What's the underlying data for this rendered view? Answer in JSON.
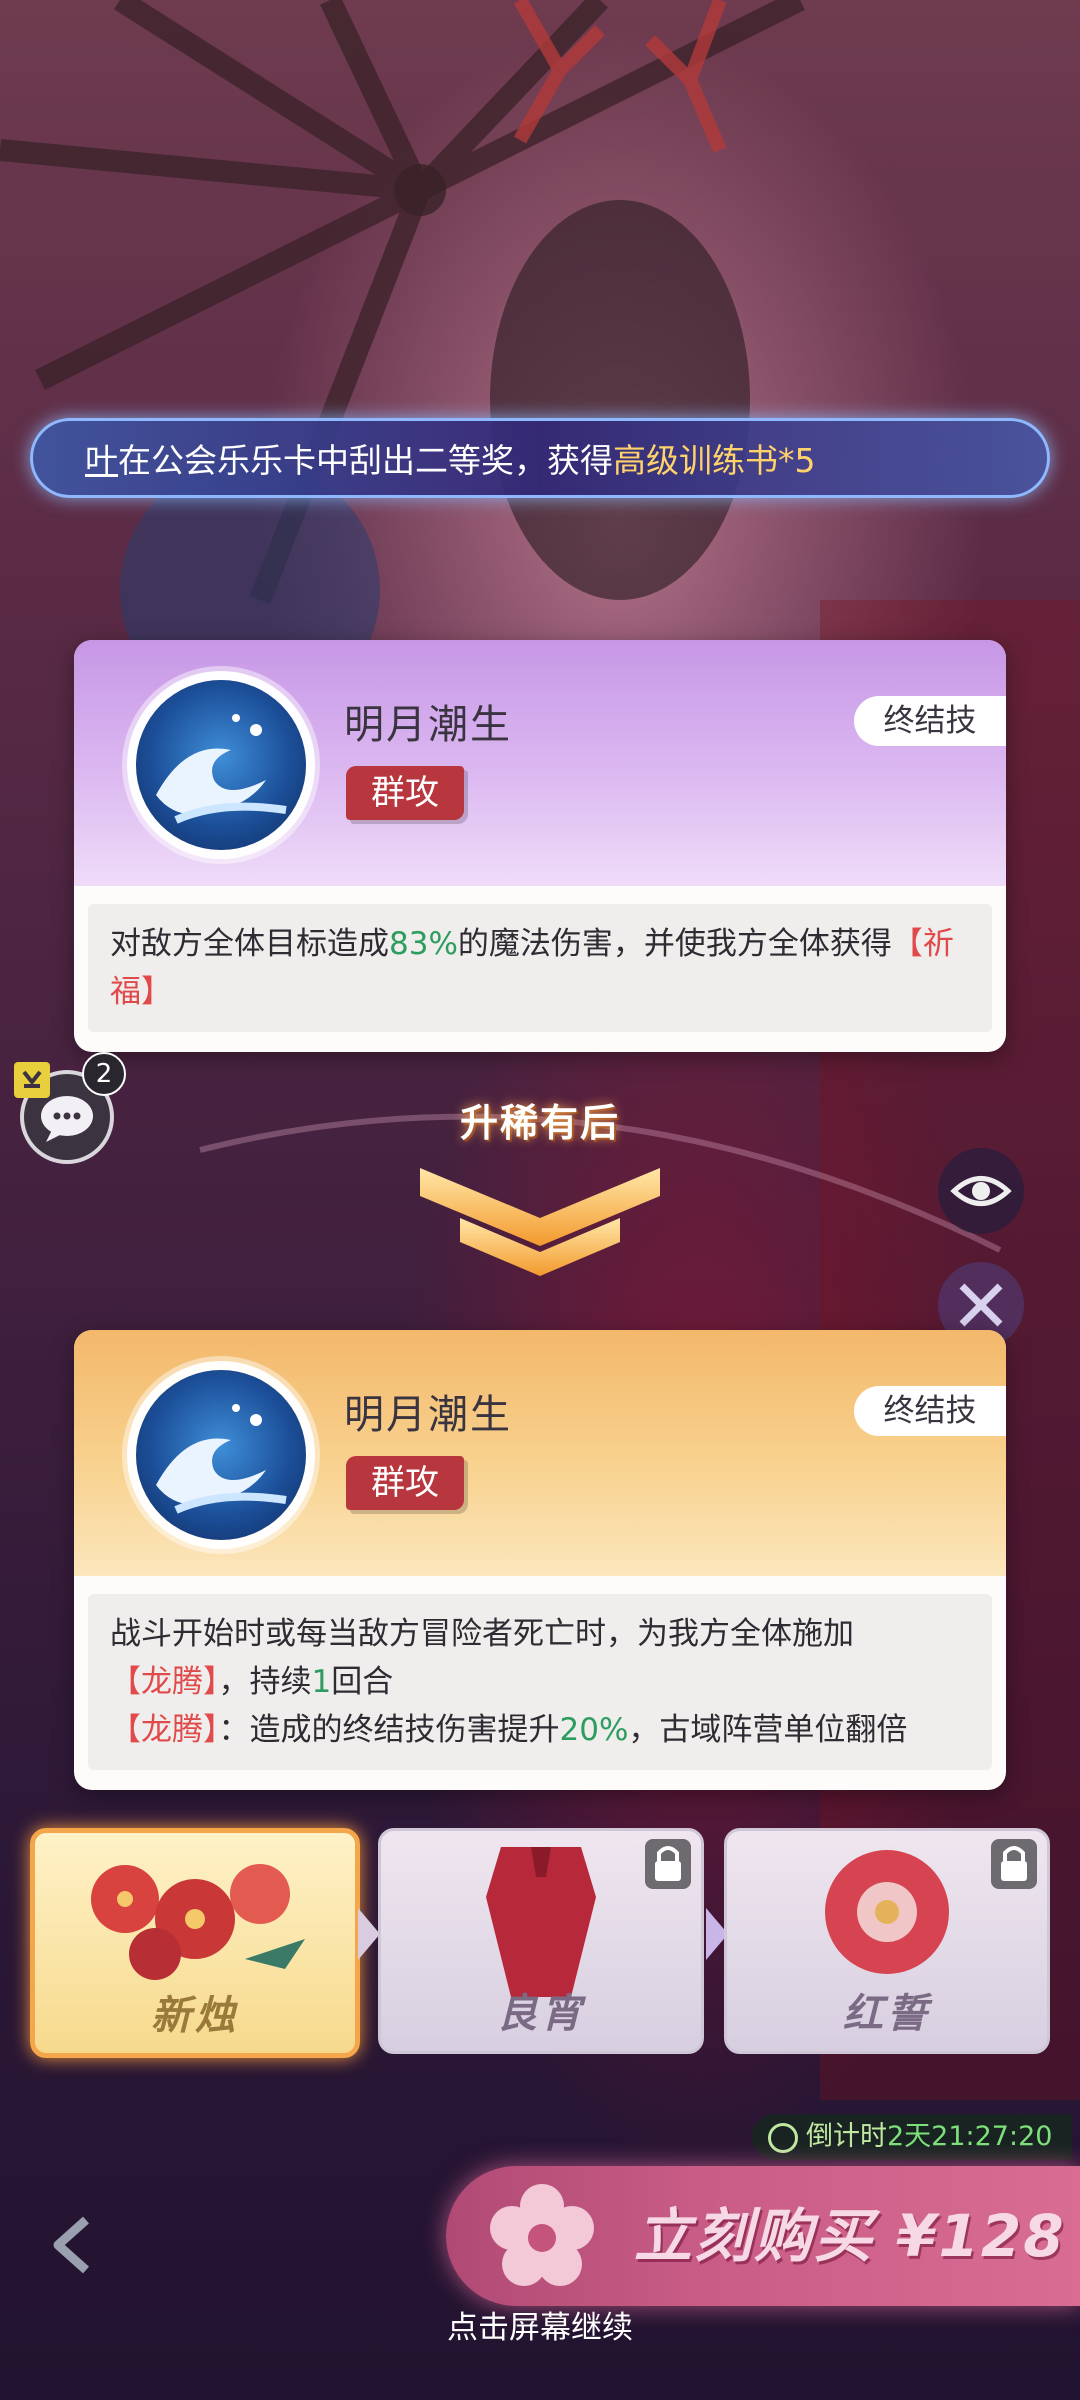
{
  "ticker": {
    "player": "叶",
    "middle": "在公会乐乐卡中刮出二等奖，获得",
    "reward": "高级训练书*5"
  },
  "skill_before": {
    "name": "明月潮生",
    "target_tag": "群攻",
    "type_tag": "终结技",
    "desc_1": "对敌方全体目标造成",
    "desc_pct": "83%",
    "desc_2": "的魔法伤害，并使我方全体获得",
    "desc_buff": "【祈福】"
  },
  "upgrade_label": "升稀有后",
  "skill_after": {
    "name": "明月潮生",
    "target_tag": "群攻",
    "type_tag": "终结技",
    "desc_1": "战斗开始时或每当敌方冒险者死亡时，为我方全体施加",
    "buff": "【龙腾】",
    "desc_2": "，持续",
    "turns": "1",
    "desc_3": "回合",
    "buff2": "【龙腾】",
    "desc_4": "：造成的终结技伤害提升",
    "pct": "20%",
    "desc_5": "，古域阵营单位翻倍"
  },
  "chat": {
    "badge": "2"
  },
  "stages": [
    {
      "label": "新烛",
      "locked": false,
      "active": true
    },
    {
      "label": "良宵",
      "locked": true,
      "active": false
    },
    {
      "label": "红誓",
      "locked": true,
      "active": false
    }
  ],
  "countdown": {
    "prefix": "倒计时",
    "value": "2天21:27:20"
  },
  "buy": {
    "label": "立刻购买 ¥128"
  },
  "continue_hint": "点击屏幕继续",
  "colors": {
    "highlight_gold": "#ffd36a",
    "green": "#2d9c5f",
    "red": "#e04a4a",
    "tag_red": "#b8363d"
  }
}
